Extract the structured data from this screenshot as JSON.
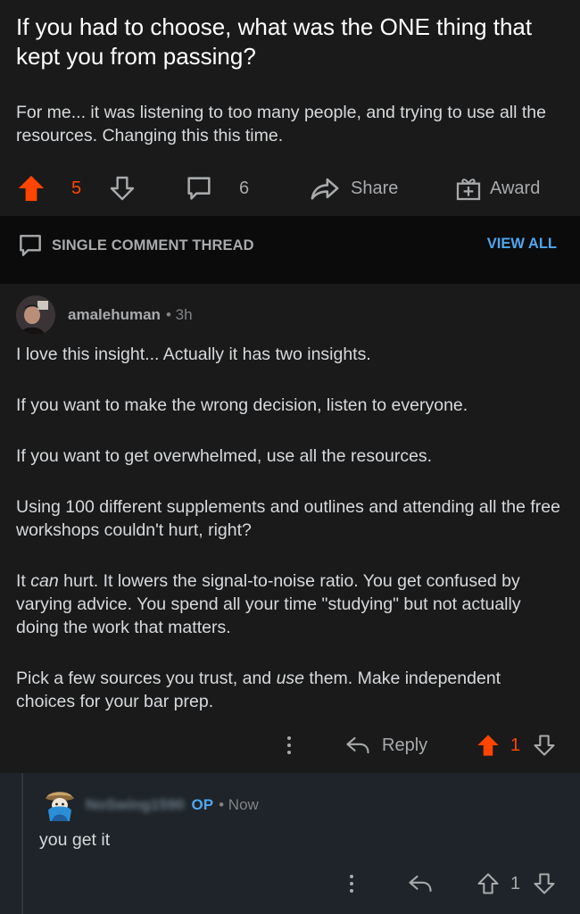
{
  "post": {
    "title": "If you had to choose, what was the ONE thing that kept you from passing?",
    "body": "For me... it was listening to too many people, and trying to use all the resources.  Changing this this time.",
    "vote_count": "5",
    "comment_count": "6",
    "share_label": "Share",
    "award_label": "Award",
    "upvote_color": "#ff4500"
  },
  "thread": {
    "label": "SINGLE COMMENT THREAD",
    "view_all": "VIEW ALL"
  },
  "comment": {
    "username": "amalehuman",
    "time": "3h",
    "paragraphs": {
      "p1": "I love this insight... Actually it has two insights.",
      "p2": "If you want to make the wrong decision, listen to everyone.",
      "p3": "If you want to get overwhelmed, use all the resources.",
      "p4": "Using 100 different supplements and outlines and attending all the free workshops couldn't hurt, right?",
      "p5_pre": "It ",
      "p5_em": "can",
      "p5_post": " hurt. It lowers the signal-to-noise ratio. You get confused by varying advice. You spend all your time \"studying\" but not actually doing the work that matters.",
      "p6_pre": "Pick a few sources you trust, and ",
      "p6_em": "use",
      "p6_post": " them. Make independent choices for your bar prep."
    },
    "reply_label": "Reply",
    "vote_count": "1"
  },
  "reply": {
    "username": "NoSwing1590",
    "op_badge": "OP",
    "time": "Now",
    "text": "you get it",
    "vote_count": "1"
  },
  "icons": {
    "upvote": "arrow-up-icon",
    "downvote": "arrow-down-icon",
    "comment": "comment-bubble-icon",
    "share": "share-arrow-icon",
    "award": "gift-award-icon",
    "more": "more-vertical-icon",
    "reply": "reply-arrow-icon"
  }
}
